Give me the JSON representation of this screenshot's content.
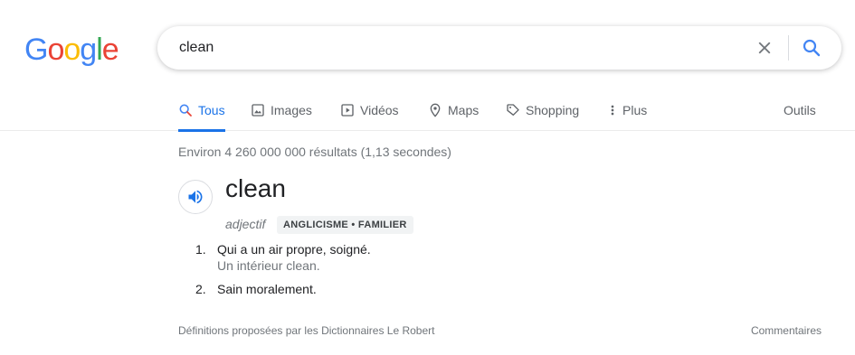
{
  "logo": {
    "letters": [
      "G",
      "o",
      "o",
      "g",
      "l",
      "e"
    ],
    "colors": [
      "#4285f4",
      "#ea4335",
      "#fbbc05",
      "#4285f4",
      "#34a853",
      "#ea4335"
    ]
  },
  "search": {
    "query": "clean"
  },
  "tabs": [
    {
      "label": "Tous",
      "icon": "search-icon",
      "active": true
    },
    {
      "label": "Images",
      "icon": "image-icon"
    },
    {
      "label": "Vidéos",
      "icon": "play-icon"
    },
    {
      "label": "Maps",
      "icon": "pin-icon"
    },
    {
      "label": "Shopping",
      "icon": "tag-icon"
    },
    {
      "label": "Plus",
      "icon": "more-vert-icon"
    }
  ],
  "tools_label": "Outils",
  "results_stats": "Environ 4 260 000 000 résultats (1,13 secondes)",
  "dictionary": {
    "word": "clean",
    "part_of_speech": "adjectif",
    "badge": "ANGLICISME • FAMILIER",
    "definitions": [
      {
        "num": "1.",
        "text": "Qui a un air propre, soigné.",
        "example": "Un intérieur clean."
      },
      {
        "num": "2.",
        "text": "Sain moralement.",
        "example": ""
      }
    ],
    "source": "Définitions proposées par les Dictionnaires Le Robert",
    "feedback": "Commentaires"
  },
  "accent": "#1a73e8"
}
